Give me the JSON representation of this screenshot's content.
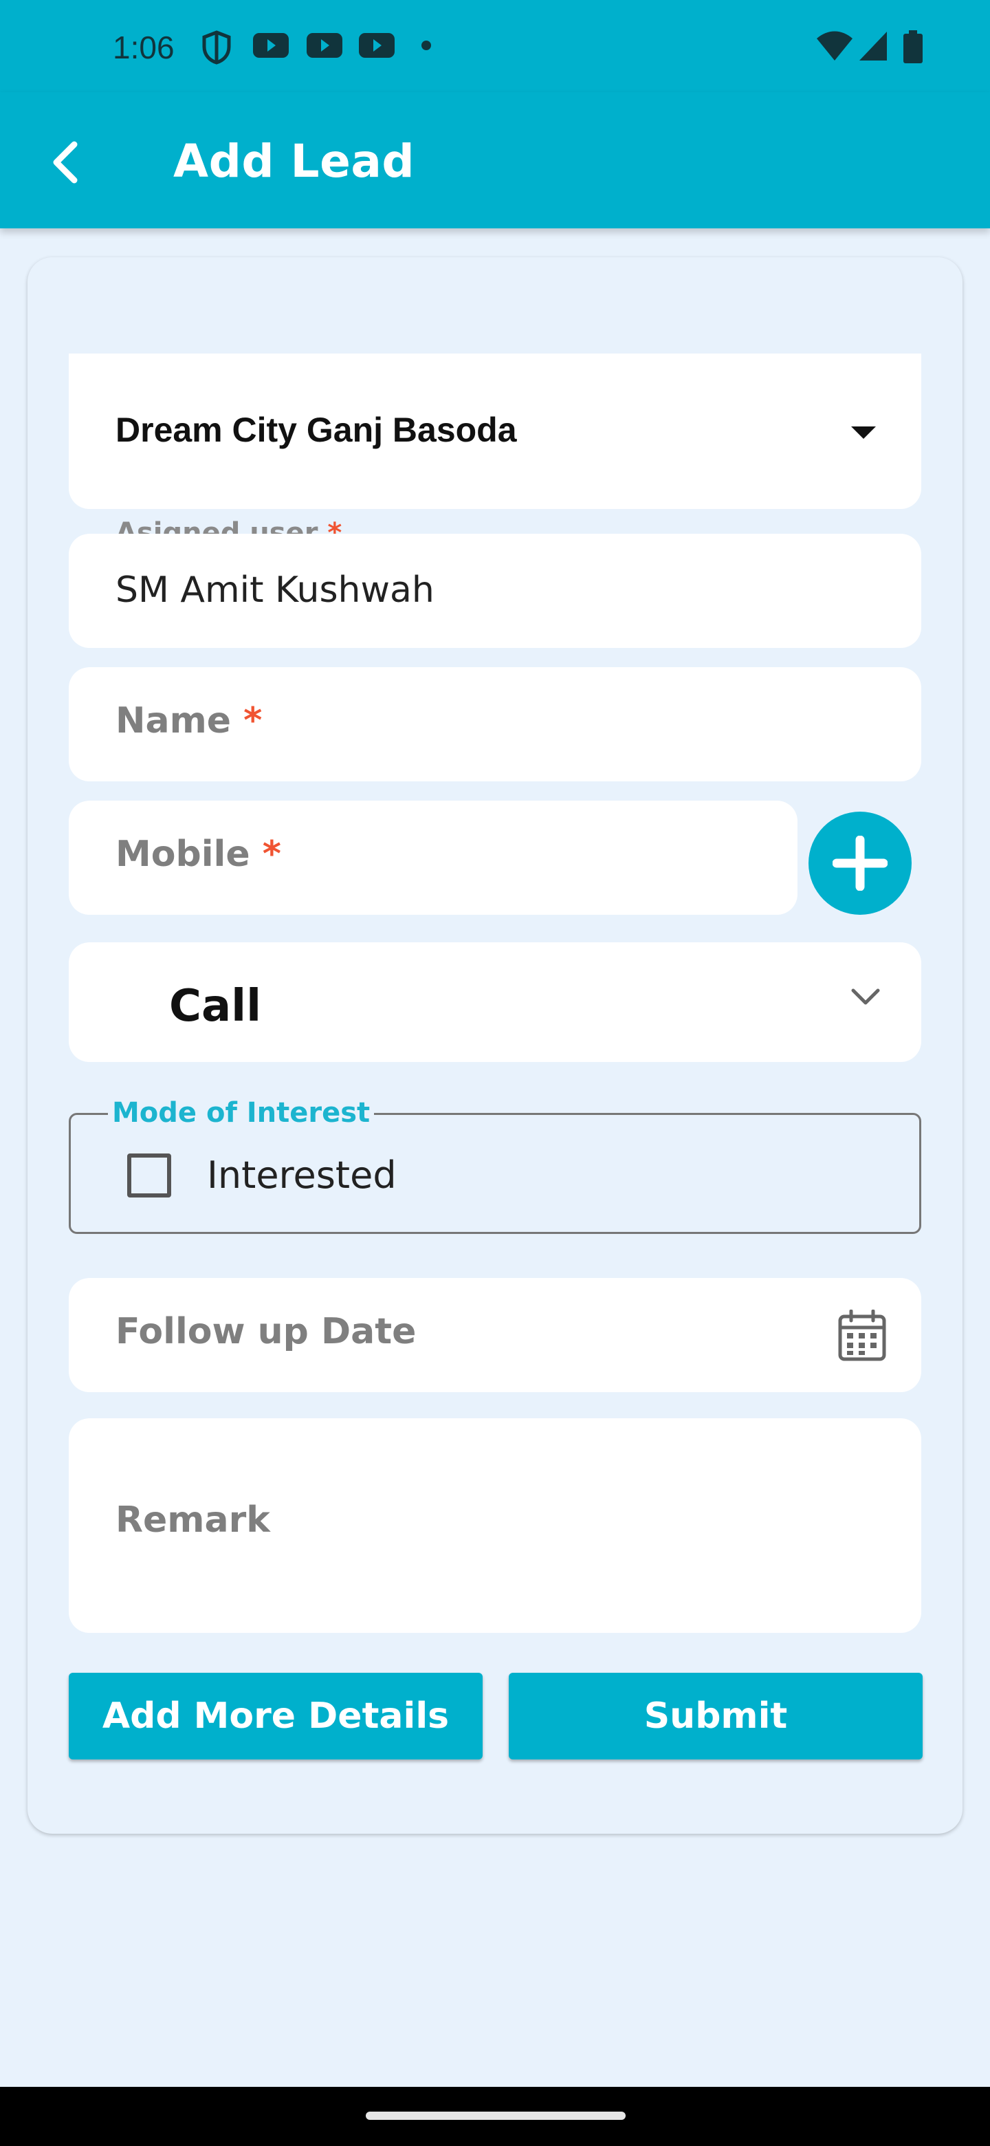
{
  "status_bar": {
    "time": "1:06",
    "icons": [
      "shield-icon",
      "youtube-icon",
      "youtube-icon",
      "youtube-icon",
      "dot-icon",
      "wifi-icon",
      "signal-icon",
      "battery-icon"
    ]
  },
  "app_bar": {
    "title": "Add Lead",
    "back_icon": "arrow-back-icon"
  },
  "form": {
    "project_select": {
      "value": "Dream City Ganj Basoda",
      "icon": "dropdown-triangle-icon"
    },
    "assigned_user": {
      "label": "Asigned user",
      "required_mark": "*",
      "value": "SM Amit Kushwah"
    },
    "name": {
      "placeholder": "Name",
      "required_mark": "*"
    },
    "mobile": {
      "placeholder": "Mobile",
      "required_mark": "*",
      "add_icon": "plus-icon"
    },
    "mode": {
      "value": "Call",
      "icon": "chevron-down-icon"
    },
    "mode_of_interest": {
      "legend": "Mode of Interest",
      "option_label": "Interested",
      "checked": false
    },
    "follow_up_date": {
      "placeholder": "Follow up Date",
      "icon": "calendar-icon"
    },
    "remark": {
      "placeholder": "Remark"
    }
  },
  "buttons": {
    "add_more_details": "Add More Details",
    "submit": "Submit"
  },
  "colors": {
    "primary": "#00b0cc",
    "background": "#e8f2fc",
    "required": "#f05432",
    "legend": "#1cb4cf"
  }
}
